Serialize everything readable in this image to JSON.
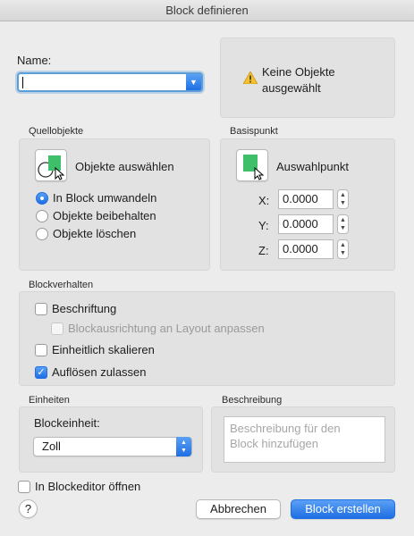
{
  "window": {
    "title": "Block definieren"
  },
  "name": {
    "label": "Name:",
    "value": ""
  },
  "warning": {
    "text_line1": "Keine Objekte",
    "text_line2": "ausgewählt",
    "icon": "warning-icon"
  },
  "source": {
    "title": "Quellobjekte",
    "select_label": "Objekte auswählen",
    "options": [
      "In Block umwandeln",
      "Objekte beibehalten",
      "Objekte löschen"
    ],
    "selected": "In Block umwandeln"
  },
  "basepoint": {
    "title": "Basispunkt",
    "pick_label": "Auswahlpunkt",
    "x_label": "X:",
    "x_value": "0.0000",
    "y_label": "Y:",
    "y_value": "0.0000",
    "z_label": "Z:",
    "z_value": "0.0000"
  },
  "behavior": {
    "title": "Blockverhalten",
    "annotative": "Beschriftung",
    "annotative_checked": false,
    "match_layout": "Blockausrichtung an Layout anpassen",
    "match_layout_checked": false,
    "uniform_scale": "Einheitlich skalieren",
    "uniform_scale_checked": false,
    "allow_explode": "Auflösen zulassen",
    "allow_explode_checked": true
  },
  "units": {
    "title": "Einheiten",
    "label": "Blockeinheit:",
    "value": "Zoll"
  },
  "description": {
    "title": "Beschreibung",
    "placeholder_line1": "Beschreibung für den",
    "placeholder_line2": "Block hinzufügen"
  },
  "open_editor": {
    "label": "In Blockeditor öffnen",
    "checked": false
  },
  "buttons": {
    "help": "?",
    "cancel": "Abbrechen",
    "create": "Block erstellen"
  },
  "colors": {
    "accent": "#1f6fe3",
    "block_green": "#3fbf6a"
  }
}
